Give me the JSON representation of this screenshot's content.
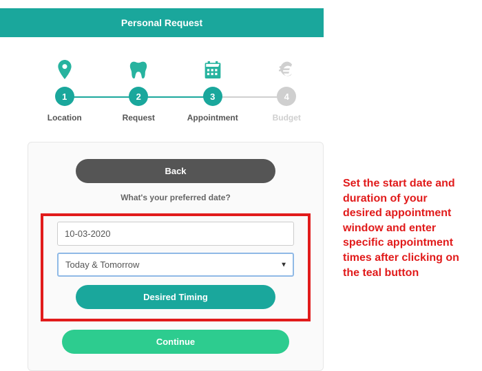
{
  "header": {
    "title": "Personal Request"
  },
  "stepper": {
    "steps": [
      {
        "num": "1",
        "label": "Location",
        "icon": "pin",
        "active": true
      },
      {
        "num": "2",
        "label": "Request",
        "icon": "tooth",
        "active": true
      },
      {
        "num": "3",
        "label": "Appointment",
        "icon": "calendar",
        "active": true
      },
      {
        "num": "4",
        "label": "Budget",
        "icon": "euro",
        "active": false
      }
    ]
  },
  "card": {
    "back_label": "Back",
    "prompt": "What's your preferred date?",
    "date_value": "10-03-2020",
    "duration_value": "Today & Tomorrow",
    "timing_label": "Desired Timing",
    "continue_label": "Continue"
  },
  "annotation": {
    "text": "Set the start date and duration of your desired appointment window and enter specific appointment times after clicking on the teal button"
  },
  "colors": {
    "teal": "#1aa79c",
    "green": "#2dcc8f",
    "grey": "#555555",
    "hl_red": "#e11b1b"
  }
}
